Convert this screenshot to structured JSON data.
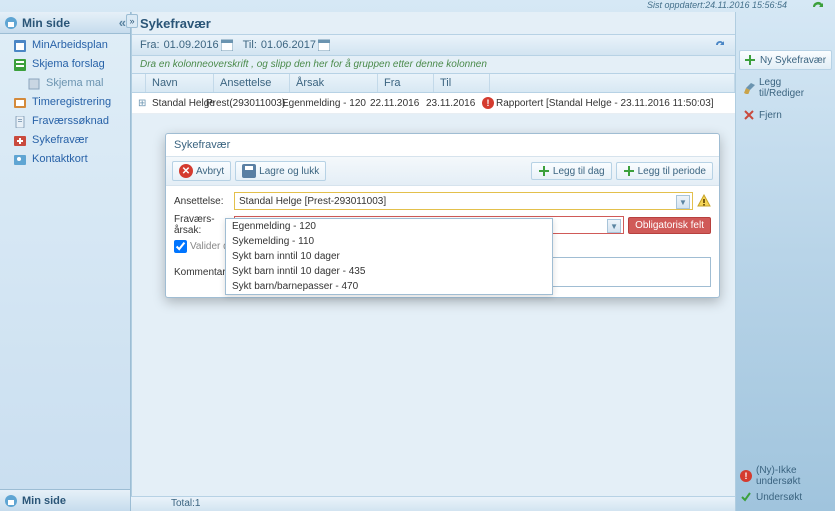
{
  "topbar": {
    "updated_label": "Sist oppdatert:24.11.2016 15:56:54"
  },
  "sidebar": {
    "title": "Min side",
    "items": [
      {
        "label": "MinArbeidsplan",
        "icon": "calendar-icon"
      },
      {
        "label": "Skjema forslag",
        "icon": "form-icon"
      },
      {
        "label": "Skjema mal",
        "icon": "template-icon",
        "sub": true
      },
      {
        "label": "Timeregistrering",
        "icon": "clock-icon"
      },
      {
        "label": "Fraværssøknad",
        "icon": "document-icon"
      },
      {
        "label": "Sykefravær",
        "icon": "medkit-icon"
      },
      {
        "label": "Kontaktkort",
        "icon": "contact-icon"
      }
    ],
    "footer": "Min side"
  },
  "main": {
    "title": "Sykefravær",
    "date_from_label": "Fra:",
    "date_from": "01.09.2016",
    "date_to_label": "Til:",
    "date_to": "01.06.2017",
    "group_hint": "Dra en kolonneoverskrift , og slipp den her for å gruppen etter denne kolonnen",
    "columns": {
      "navn": "Navn",
      "ansettelse": "Ansettelse",
      "arsak": "Årsak",
      "fra": "Fra",
      "til": "Til"
    },
    "rows": [
      {
        "navn": "Standal Helge",
        "ansettelse": "Prest(293011003)",
        "arsak": "Egenmelding - 120",
        "fra": "22.11.2016",
        "til": "23.11.2016",
        "status": "Rapportert [Standal Helge - 23.11.2016 11:50:03]"
      }
    ],
    "footer_total": "Total:1"
  },
  "right_panel": {
    "new_btn": "Ny Sykefravær",
    "edit_btn": "Legg til/Rediger",
    "remove_btn": "Fjern",
    "legend_not_examined": "(Ny)-Ikke undersøkt",
    "legend_examined": "Undersøkt"
  },
  "dialog": {
    "title": "Sykefravær",
    "cancel": "Avbryt",
    "save": "Lagre og lukk",
    "add_day": "Legg til dag",
    "add_period": "Legg til periode",
    "field_ansettelse_label": "Ansettelse:",
    "field_ansettelse_value": "Standal Helge [Prest-293011003]",
    "field_arsak_label": "Fraværs-årsak:",
    "field_arsak_value": "",
    "oblig_badge": "Obligatorisk felt",
    "valider_dato": "Valider dato",
    "kommentar_label": "Kommentar:",
    "dropdown_options": [
      "Egenmelding - 120",
      "Sykemelding - 110",
      "Sykt barn inntil 10 dager",
      "Sykt barn inntil 10 dager - 435",
      "Sykt barn/barnepasser - 470"
    ]
  }
}
